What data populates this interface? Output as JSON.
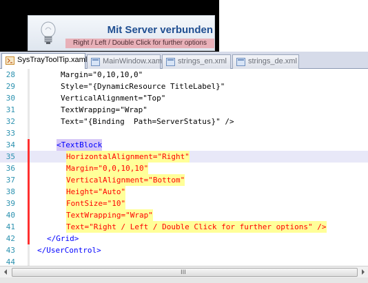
{
  "preview": {
    "title": "Mit Server verbunden",
    "hint": "Right / Left / Double Click for further options",
    "icon": "lightbulb-icon"
  },
  "tabs": [
    {
      "label": "SysTrayToolTip.xaml",
      "active": true
    },
    {
      "label": "MainWindow.xaml",
      "active": false
    },
    {
      "label": "strings_en.xml",
      "active": false
    },
    {
      "label": "strings_de.xml",
      "active": false
    }
  ],
  "editor": {
    "lines": [
      {
        "n": "28",
        "text": "Margin=\"0,10,10,0\""
      },
      {
        "n": "29",
        "text": "Style=\"{DynamicResource TitleLabel}\""
      },
      {
        "n": "30",
        "text": "VerticalAlignment=\"Top\""
      },
      {
        "n": "31",
        "text": "TextWrapping=\"Wrap\""
      },
      {
        "n": "32",
        "text": "Text=\"{Binding  Path=ServerStatus}\" />"
      },
      {
        "n": "33",
        "text": ""
      },
      {
        "n": "34",
        "text": "<TextBlock"
      },
      {
        "n": "35",
        "text": "HorizontalAlignment=\"Right\""
      },
      {
        "n": "36",
        "text": "Margin=\"0,0,10,10\""
      },
      {
        "n": "37",
        "text": "VerticalAlignment=\"Bottom\""
      },
      {
        "n": "38",
        "text": "Height=\"Auto\""
      },
      {
        "n": "39",
        "text": "FontSize=\"10\""
      },
      {
        "n": "40",
        "text": "TextWrapping=\"Wrap\""
      },
      {
        "n": "41",
        "text": "Text=\"Right / Left / Double Click for further options\" />"
      },
      {
        "n": "42",
        "text": "</Grid>"
      },
      {
        "n": "43",
        "text": "</UserControl>"
      },
      {
        "n": "44",
        "text": ""
      }
    ]
  },
  "scrollbar": {
    "grip": "III"
  }
}
